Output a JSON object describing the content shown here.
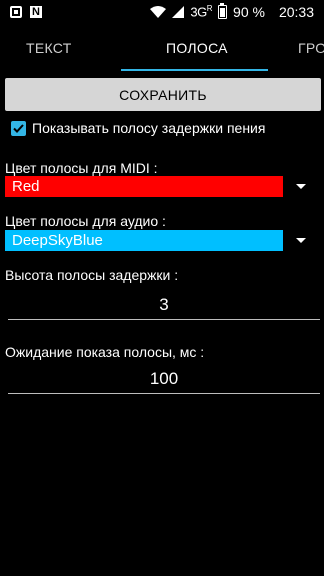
{
  "status_bar": {
    "network": "3G",
    "network_sup": "R",
    "battery": "90 %",
    "time": "20:33"
  },
  "tabs": [
    {
      "label": "ТЕКСТ"
    },
    {
      "label": "ПОЛОСА"
    },
    {
      "label": "ГРО"
    }
  ],
  "save_label": "СОХРАНИТЬ",
  "show_delay_bar": {
    "checked": true,
    "label": "Показывать полосу задержки пения"
  },
  "midi_color": {
    "label": "Цвет полосы для MIDI :",
    "value": "Red",
    "swatch": "#ff0000"
  },
  "audio_color": {
    "label": "Цвет полосы для аудио :",
    "value": "DeepSkyBlue",
    "swatch": "#00bfff"
  },
  "delay_height": {
    "label": "Высота полосы задержки :",
    "value": "3"
  },
  "show_wait": {
    "label": "Ожидание показа полосы, мс :",
    "value": "100"
  },
  "colors": {
    "accent": "#33b5e5",
    "background": "#000000",
    "button": "#d6d6d6"
  }
}
